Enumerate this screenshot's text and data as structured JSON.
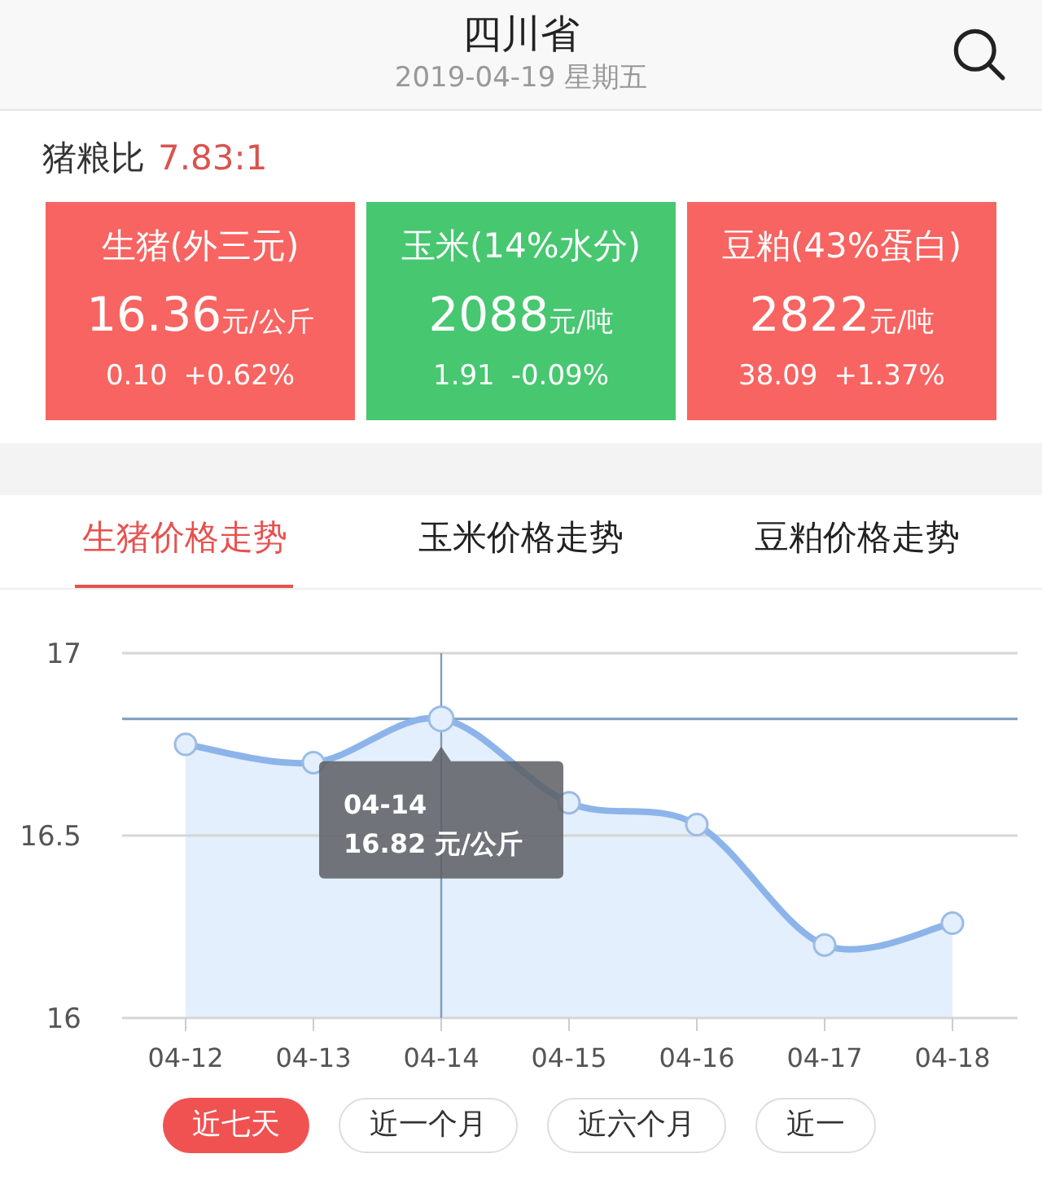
{
  "header": {
    "title": "四川省",
    "date": "2019-04-19 星期五"
  },
  "ratio": {
    "label": "猪粮比",
    "value": "7.83:1"
  },
  "cards": [
    {
      "name": "生猪(外三元)",
      "value": "16.36",
      "unit": "元/公斤",
      "change": "0.10",
      "percent": "+0.62%",
      "color": "#f86461"
    },
    {
      "name": "玉米(14%水分)",
      "value": "2088",
      "unit": "元/吨",
      "change": "1.91",
      "percent": "-0.09%",
      "color": "#47c770"
    },
    {
      "name": "豆粕(43%蛋白)",
      "value": "2822",
      "unit": "元/吨",
      "change": "38.09",
      "percent": "+1.37%",
      "color": "#f86461"
    }
  ],
  "tabs": [
    {
      "label": "生猪价格走势",
      "selected": true
    },
    {
      "label": "玉米价格走势",
      "selected": false
    },
    {
      "label": "豆粕价格走势",
      "selected": false
    }
  ],
  "chart": {
    "chart_data": {
      "type": "area",
      "categories": [
        "04-12",
        "04-13",
        "04-14",
        "04-15",
        "04-16",
        "04-17",
        "04-18"
      ],
      "series": [
        {
          "color": "#8db4ea",
          "values": [
            16.75,
            16.7,
            16.82,
            16.59,
            16.53,
            16.2,
            16.26
          ]
        }
      ],
      "ylim": [
        16,
        17
      ],
      "yticks": [
        16,
        16.5,
        17
      ],
      "ref_lines": [
        {
          "axis": "y",
          "value": 16.5,
          "color": "#d6d6d6"
        },
        {
          "axis": "x",
          "value": "04-14"
        },
        {
          "axis": "y",
          "value": 16.82
        }
      ]
    },
    "points": [
      {
        "selected": false
      },
      {
        "selected": false
      },
      {
        "selected": true
      },
      {
        "selected": false
      },
      {
        "selected": false
      },
      {
        "selected": false
      },
      {
        "selected": false
      }
    ],
    "tooltip": {
      "date": "04-14",
      "value": "16.82 元/公斤"
    }
  },
  "ranges": [
    {
      "label": "近七天",
      "selected": true
    },
    {
      "label": "近一个月",
      "selected": false
    },
    {
      "label": "近六个月",
      "selected": false
    },
    {
      "label": "近一",
      "selected": false
    }
  ]
}
